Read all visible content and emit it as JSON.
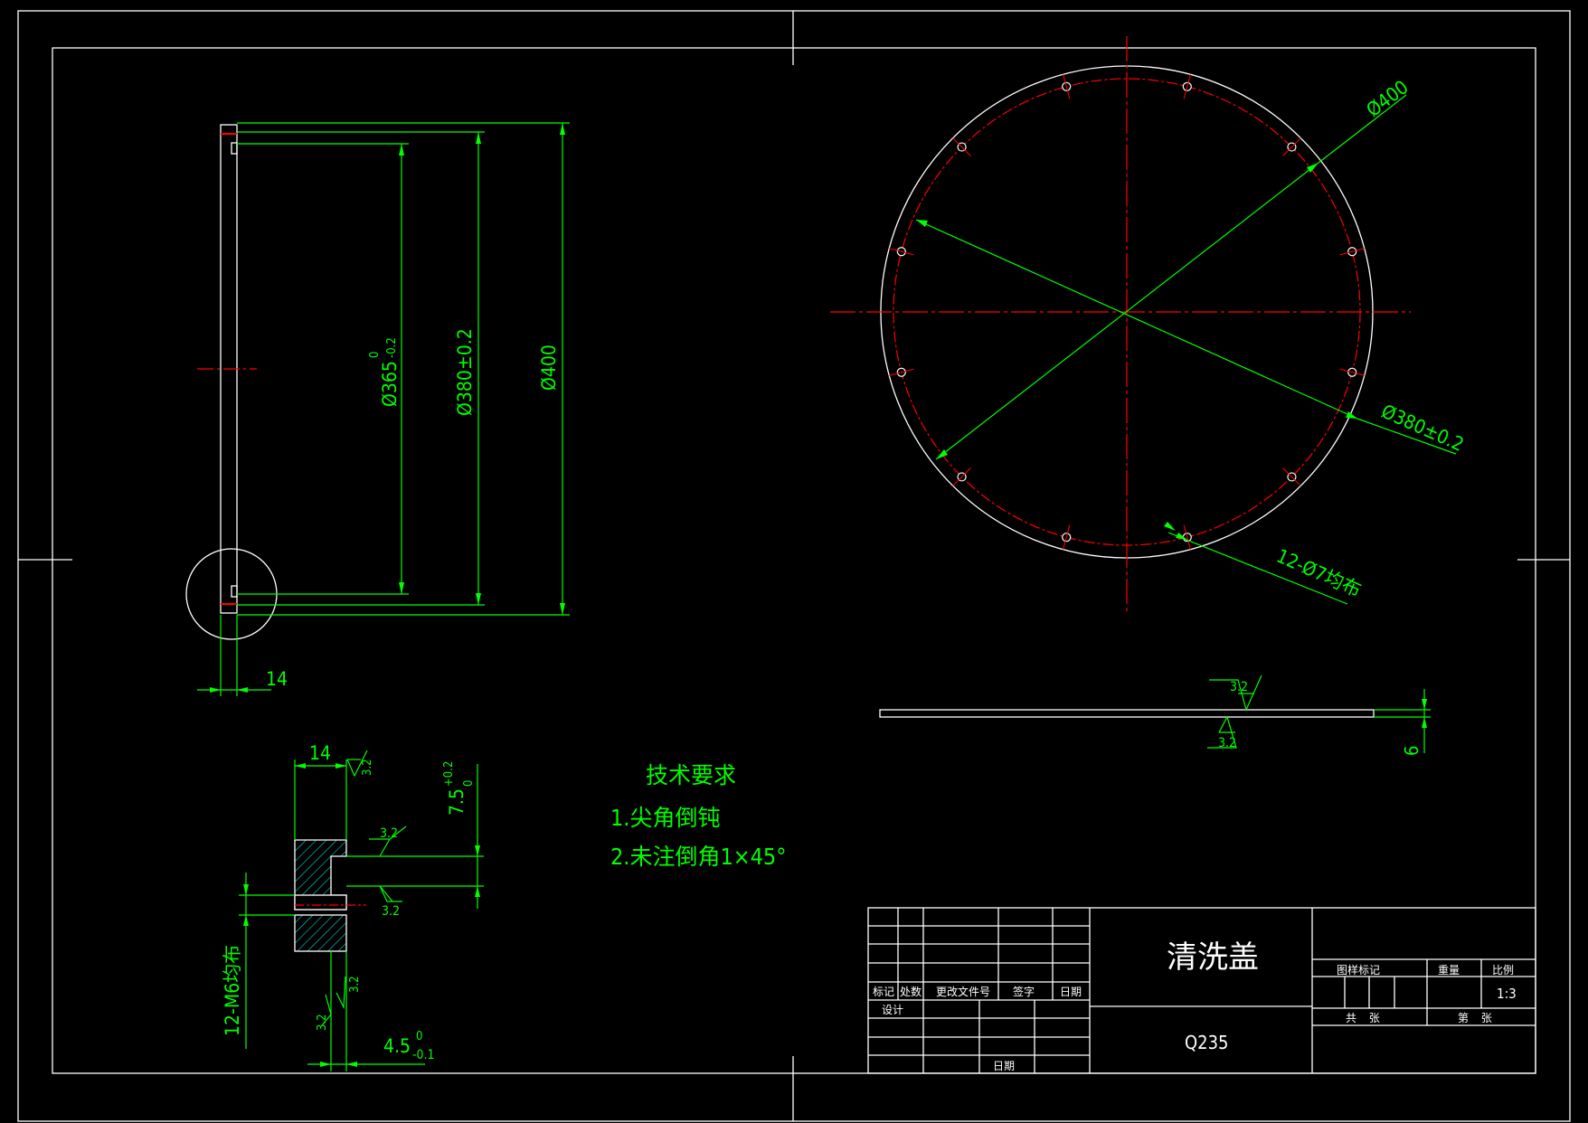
{
  "colors": {
    "background": "#000000",
    "frame": "#ffffff",
    "dimension": "#00ff00",
    "centerline": "#ff0000",
    "hatch": "#00ffff",
    "text": "#00ff00",
    "titleText": "#ffffff"
  },
  "side_view": {
    "thickness_dim": "14",
    "dim_inner": "Ø365",
    "dim_inner_tol_upper": "0",
    "dim_inner_tol_lower": "-0.2",
    "dim_bolt_circle": "Ø380±0.2",
    "dim_outer": "Ø400"
  },
  "top_view": {
    "dim_outer": "Ø400",
    "dim_bolt_circle": "Ø380±0.2",
    "holes_note": "12-Ø7均布"
  },
  "edge_view": {
    "roughness_top": "3.2",
    "roughness_bottom": "3.2",
    "thickness_dim": "6"
  },
  "detail_view": {
    "width_dim": "14",
    "roughness_top": "3.2",
    "depth_dim": "7.5",
    "depth_tol_upper": "+0.2",
    "depth_tol_lower": "0",
    "roughness_right1": "3.2",
    "roughness_right2": "3.2",
    "thread_note": "12-M6均布",
    "roughness_bottom1": "3.2",
    "roughness_bottom2": "3.2",
    "step_dim": "4.5",
    "step_tol_upper": "0",
    "step_tol_lower": "-0.1"
  },
  "tech_requirements": {
    "title": "技术要求",
    "items": [
      "1.尖角倒钝",
      "2.未注倒角1×45°"
    ]
  },
  "title_block": {
    "part_name": "清洗盖",
    "material": "Q235",
    "col_mark": "标记",
    "col_count": "处数",
    "col_change_doc": "更改文件号",
    "col_signature": "签字",
    "col_date": "日期",
    "design": "设计",
    "date_label": "日期",
    "drawing_mark": "图样标记",
    "weight": "重量",
    "scale_label": "比例",
    "scale_value": "1:3",
    "total_sheets": "共    张",
    "sheet_no": "第    张"
  }
}
